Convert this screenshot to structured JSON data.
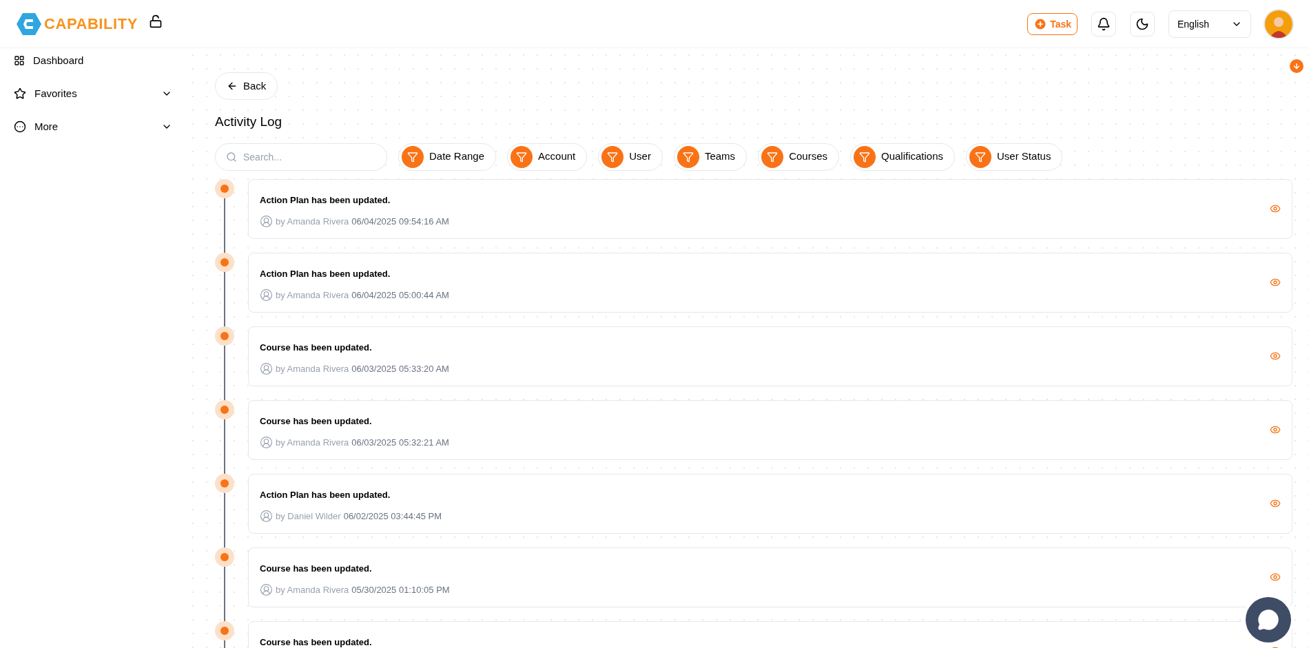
{
  "brand": {
    "name": "CAPABILITY"
  },
  "header": {
    "task_button": "Task",
    "language": "English"
  },
  "sidebar": {
    "items": [
      {
        "label": "Dashboard",
        "kind": "link"
      },
      {
        "label": "Favorites",
        "kind": "group"
      },
      {
        "label": "More",
        "kind": "group"
      }
    ]
  },
  "back_button": "Back",
  "title": "Activity Log",
  "search": {
    "placeholder": "Search..."
  },
  "filters": [
    "Date Range",
    "Account",
    "User",
    "Teams",
    "Courses",
    "Qualifications",
    "User Status"
  ],
  "activities": [
    {
      "title": "Action Plan has been updated.",
      "by": "by Amanda Rivera",
      "time": "06/04/2025 09:54:16 AM"
    },
    {
      "title": "Action Plan has been updated.",
      "by": "by Amanda Rivera",
      "time": "06/04/2025 05:00:44 AM"
    },
    {
      "title": "Course has been updated.",
      "by": "by Amanda Rivera",
      "time": "06/03/2025 05:33:20 AM"
    },
    {
      "title": "Course has been updated.",
      "by": "by Amanda Rivera",
      "time": "06/03/2025 05:32:21 AM"
    },
    {
      "title": "Action Plan has been updated.",
      "by": "by Daniel Wilder",
      "time": "06/02/2025 03:44:45 PM"
    },
    {
      "title": "Course has been updated.",
      "by": "by Amanda Rivera",
      "time": "05/30/2025 01:10:05 PM"
    },
    {
      "title": "Course has been updated."
    }
  ]
}
